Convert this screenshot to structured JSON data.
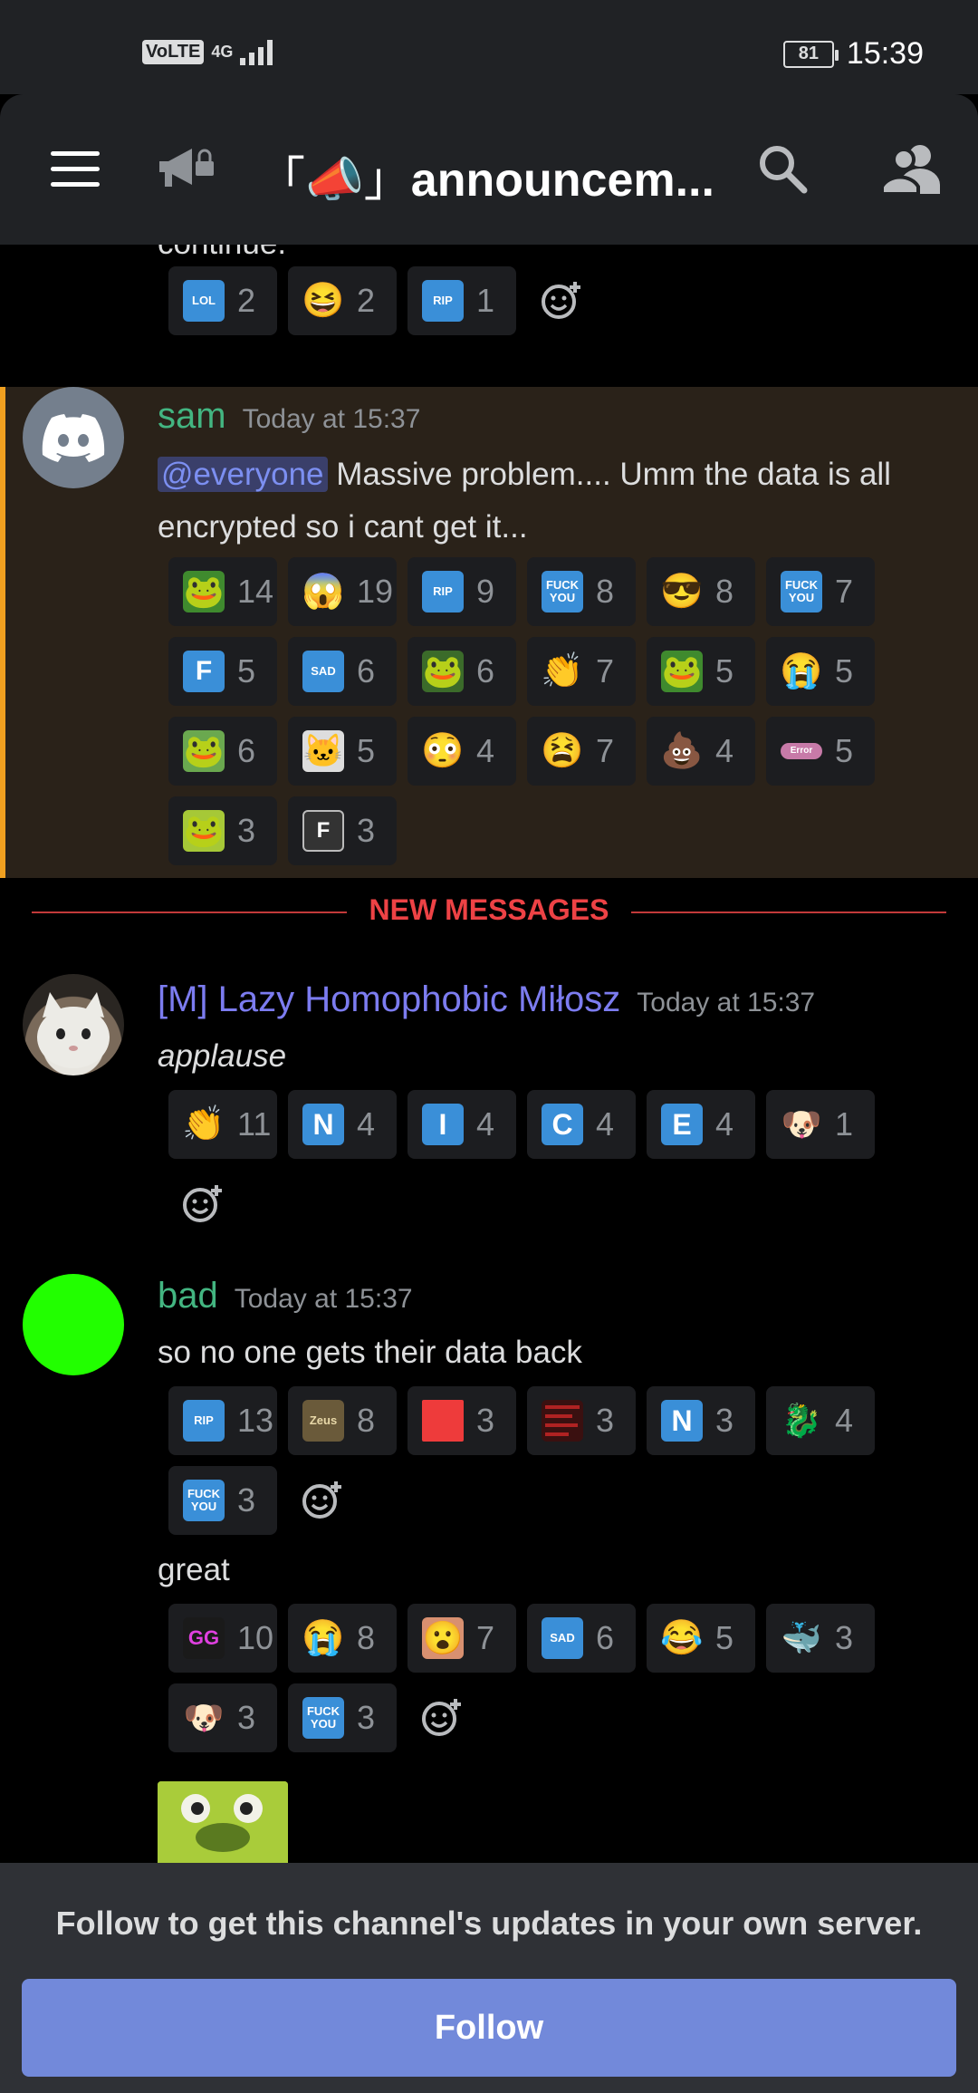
{
  "status_bar": {
    "network": "VoLTE",
    "signal": "4G",
    "battery": "81",
    "time": "15:39"
  },
  "header": {
    "title": "「📣」announcem...",
    "title_emoji": "📣",
    "title_text": "announcem..."
  },
  "messages": [
    {
      "continued_text": "continue.",
      "reactions": [
        {
          "emoji_name": "lol-emote",
          "label": "LOL",
          "count": "2"
        },
        {
          "emoji_name": "laughing-emoji",
          "glyph": "😆",
          "count": "2"
        },
        {
          "emoji_name": "rip-emote",
          "label": "RIP",
          "count": "1"
        }
      ]
    },
    {
      "author": "sam",
      "author_color": "#43b581",
      "timestamp": "Today at 15:37",
      "mention": "@everyone",
      "text_line1": "Massive problem.... Umm the data is all",
      "text_line2": "encrypted so i cant get it...",
      "reactions": [
        {
          "emoji_name": "pepe-emote",
          "glyph": "🐸",
          "count": "14"
        },
        {
          "emoji_name": "scream-emoji",
          "glyph": "😱",
          "count": "19"
        },
        {
          "emoji_name": "rip-emote",
          "label": "RIP",
          "count": "9"
        },
        {
          "emoji_name": "fuck-you-emote",
          "label": "FUCK YOU",
          "count": "8"
        },
        {
          "emoji_name": "sunglasses-emoji",
          "glyph": "😎",
          "count": "8"
        },
        {
          "emoji_name": "fuck-you-emote",
          "label": "FUCK YOU",
          "count": "7"
        },
        {
          "emoji_name": "f-emote",
          "label": "F",
          "count": "5"
        },
        {
          "emoji_name": "sad-emote",
          "label": "SAD",
          "count": "6"
        },
        {
          "emoji_name": "pepe-emote",
          "glyph": "🐸",
          "count": "6"
        },
        {
          "emoji_name": "clap-emoji",
          "glyph": "👏",
          "count": "7"
        },
        {
          "emoji_name": "pepe-emote",
          "glyph": "🐸",
          "count": "5"
        },
        {
          "emoji_name": "sob-emoji",
          "glyph": "😭",
          "count": "5"
        },
        {
          "emoji_name": "frog-emote",
          "glyph": "🐸",
          "count": "6"
        },
        {
          "emoji_name": "cat-emote",
          "glyph": "🐱",
          "count": "5"
        },
        {
          "emoji_name": "flushed-emoji",
          "glyph": "😳",
          "count": "4"
        },
        {
          "emoji_name": "tired-face-emoji",
          "glyph": "😫",
          "count": "7"
        },
        {
          "emoji_name": "poop-emoji",
          "glyph": "💩",
          "count": "4"
        },
        {
          "emoji_name": "error-emote",
          "label": "Error",
          "count": "5"
        },
        {
          "emoji_name": "frog-face-emote",
          "glyph": "🐸",
          "count": "3"
        },
        {
          "emoji_name": "f-key-emote",
          "label": "F",
          "count": "3"
        }
      ]
    },
    {
      "divider": "NEW MESSAGES",
      "author": "[M] Lazy Homophobic Miłosz",
      "author_color": "#7c7cf0",
      "timestamp": "Today at 15:37",
      "text": "applause",
      "reactions": [
        {
          "emoji_name": "clap-emoji",
          "glyph": "👏",
          "count": "11"
        },
        {
          "emoji_name": "letter-n-emote",
          "label": "N",
          "count": "4"
        },
        {
          "emoji_name": "letter-i-emote",
          "label": "I",
          "count": "4"
        },
        {
          "emoji_name": "letter-c-emote",
          "label": "C",
          "count": "4"
        },
        {
          "emoji_name": "letter-e-emote",
          "label": "E",
          "count": "4"
        },
        {
          "emoji_name": "dog-emote",
          "glyph": "🐶",
          "count": "1"
        }
      ]
    },
    {
      "author": "bad",
      "author_color": "#43b581",
      "timestamp": "Today at 15:37",
      "avatar_color": "#22ff00",
      "text": "so no one gets their data back",
      "reactions": [
        {
          "emoji_name": "rip-emote",
          "label": "RIP",
          "count": "13"
        },
        {
          "emoji_name": "zeus-emote",
          "label": "Zeus",
          "count": "8"
        },
        {
          "emoji_name": "red-square-emote",
          "label": "",
          "count": "3"
        },
        {
          "emoji_name": "red-text-emote",
          "label": "",
          "count": "3"
        },
        {
          "emoji_name": "letter-n-emote",
          "label": "N",
          "count": "3"
        },
        {
          "emoji_name": "blue-creature-emote",
          "glyph": "🐉",
          "count": "4"
        },
        {
          "emoji_name": "fuck-you-emote",
          "label": "FUCK YOU",
          "count": "3"
        }
      ],
      "text2": "great",
      "reactions2": [
        {
          "emoji_name": "gg-emote",
          "label": "GG",
          "count": "10"
        },
        {
          "emoji_name": "sob-emoji",
          "glyph": "😭",
          "count": "8"
        },
        {
          "emoji_name": "face-emote",
          "glyph": "😮",
          "count": "7"
        },
        {
          "emoji_name": "sad-emote",
          "label": "SAD",
          "count": "6"
        },
        {
          "emoji_name": "joy-emoji",
          "glyph": "😂",
          "count": "5"
        },
        {
          "emoji_name": "blue-blob-emote",
          "glyph": "🐳",
          "count": "3"
        },
        {
          "emoji_name": "dog-emote",
          "glyph": "🐶",
          "count": "3"
        },
        {
          "emoji_name": "fuck-you-emote",
          "label": "FUCK YOU",
          "count": "3"
        }
      ]
    }
  ],
  "footer": {
    "text": "Follow to get this channel's updates in your own server.",
    "button": "Follow"
  },
  "colors": {
    "accent": "#7289da",
    "mention_bar": "#f0a020",
    "new_messages": "#ed4245"
  }
}
